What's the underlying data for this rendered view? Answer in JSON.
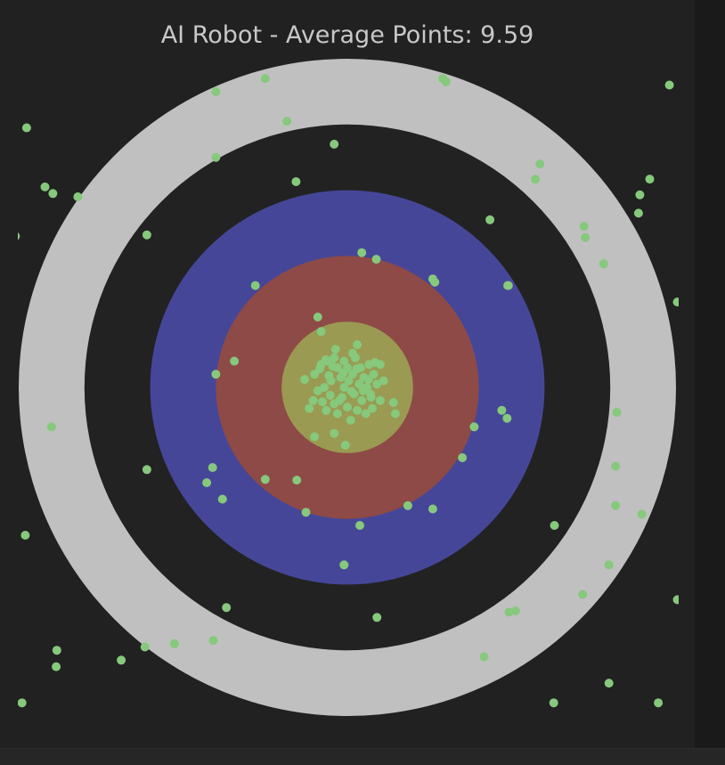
{
  "chart_data": {
    "type": "scatter",
    "title": "AI Robot - Average Points: 9.59",
    "xlabel": "",
    "ylabel": "",
    "xlim": [
      -5.5,
      5.5
    ],
    "ylim": [
      -5.5,
      5.5
    ],
    "grid": false,
    "rings": [
      {
        "radius": 5,
        "color": "#c0c0c0"
      },
      {
        "radius": 4,
        "color": "#222222"
      },
      {
        "radius": 3,
        "color": "#464699"
      },
      {
        "radius": 2,
        "color": "#8e4a46"
      },
      {
        "radius": 1,
        "color": "#9a9a52"
      }
    ],
    "point_color": "#86c87c",
    "points": [
      [
        -4.88,
        3.95
      ],
      [
        -4.6,
        3.05
      ],
      [
        -4.48,
        2.95
      ],
      [
        -4.1,
        2.9
      ],
      [
        -5.05,
        2.3
      ],
      [
        -3.05,
        2.32
      ],
      [
        -2.0,
        3.5
      ],
      [
        -2.0,
        4.5
      ],
      [
        -1.25,
        4.7
      ],
      [
        -0.92,
        4.05
      ],
      [
        -0.78,
        3.13
      ],
      [
        -0.2,
        3.7
      ],
      [
        1.45,
        4.7
      ],
      [
        1.5,
        4.65
      ],
      [
        4.9,
        4.6
      ],
      [
        2.93,
        3.4
      ],
      [
        2.86,
        3.17
      ],
      [
        4.6,
        3.17
      ],
      [
        4.45,
        2.93
      ],
      [
        4.43,
        2.65
      ],
      [
        3.6,
        2.45
      ],
      [
        3.62,
        2.28
      ],
      [
        3.9,
        1.88
      ],
      [
        2.17,
        2.55
      ],
      [
        5.02,
        1.3
      ],
      [
        2.45,
        1.55
      ],
      [
        4.1,
        -0.38
      ],
      [
        4.08,
        -1.2
      ],
      [
        4.08,
        -1.8
      ],
      [
        4.48,
        -1.93
      ],
      [
        3.15,
        -2.1
      ],
      [
        3.98,
        -2.7
      ],
      [
        3.58,
        -3.15
      ],
      [
        2.56,
        -3.4
      ],
      [
        2.46,
        -3.42
      ],
      [
        5.02,
        -3.23
      ],
      [
        3.98,
        -4.5
      ],
      [
        3.14,
        -4.8
      ],
      [
        4.73,
        -4.8
      ],
      [
        2.08,
        -4.1
      ],
      [
        0.45,
        -3.5
      ],
      [
        -4.42,
        -4.0
      ],
      [
        -4.43,
        -4.25
      ],
      [
        -3.44,
        -4.15
      ],
      [
        -3.08,
        -3.95
      ],
      [
        -2.63,
        -3.9
      ],
      [
        -2.04,
        -3.85
      ],
      [
        -1.84,
        -3.35
      ],
      [
        -4.95,
        -4.8
      ],
      [
        -4.9,
        -2.25
      ],
      [
        -4.5,
        -0.6
      ],
      [
        -3.05,
        -1.25
      ],
      [
        -2.05,
        -1.22
      ],
      [
        -2.14,
        -1.45
      ],
      [
        -1.9,
        -1.7
      ],
      [
        -1.25,
        -1.4
      ],
      [
        -0.77,
        -1.41
      ],
      [
        -0.63,
        -1.9
      ],
      [
        -0.05,
        -2.7
      ],
      [
        0.19,
        -2.1
      ],
      [
        0.92,
        -1.8
      ],
      [
        1.3,
        -1.85
      ],
      [
        1.75,
        -1.07
      ],
      [
        1.93,
        -0.6
      ],
      [
        2.35,
        -0.35
      ],
      [
        2.43,
        -0.47
      ],
      [
        -2.0,
        0.2
      ],
      [
        -1.72,
        0.4
      ],
      [
        -0.45,
        1.07
      ],
      [
        -0.4,
        0.85
      ],
      [
        0.22,
        2.05
      ],
      [
        0.44,
        1.95
      ],
      [
        -1.4,
        1.55
      ],
      [
        1.3,
        1.65
      ],
      [
        1.33,
        1.6
      ],
      [
        2.44,
        1.55
      ],
      [
        0.35,
        -0.1
      ],
      [
        0.73,
        -0.4
      ],
      [
        0.7,
        -0.23
      ],
      [
        -0.5,
        -0.75
      ],
      [
        -0.2,
        -0.7
      ],
      [
        -0.03,
        -0.88
      ],
      [
        0.15,
        0.65
      ],
      [
        -0.18,
        0.58
      ],
      [
        0.5,
        0.35
      ],
      [
        -0.65,
        0.12
      ],
      [
        -0.52,
        -0.2
      ],
      [
        -0.5,
        0.2
      ],
      [
        -0.4,
        0.35
      ],
      [
        -0.35,
        0.0
      ],
      [
        -0.32,
        -0.35
      ],
      [
        -0.3,
        0.4
      ],
      [
        -0.25,
        0.1
      ],
      [
        -0.2,
        0.45
      ],
      [
        -0.2,
        -0.25
      ],
      [
        -0.15,
        0.3
      ],
      [
        -0.15,
        -0.4
      ],
      [
        -0.1,
        0.15
      ],
      [
        -0.08,
        -0.15
      ],
      [
        -0.05,
        0.4
      ],
      [
        -0.05,
        0.0
      ],
      [
        0.0,
        0.3
      ],
      [
        0.0,
        -0.3
      ],
      [
        0.02,
        0.1
      ],
      [
        0.05,
        -0.5
      ],
      [
        0.08,
        0.2
      ],
      [
        0.1,
        -0.1
      ],
      [
        0.12,
        0.45
      ],
      [
        0.15,
        -0.35
      ],
      [
        0.18,
        0.05
      ],
      [
        0.2,
        0.3
      ],
      [
        0.22,
        -0.2
      ],
      [
        0.25,
        0.15
      ],
      [
        0.28,
        -0.4
      ],
      [
        0.3,
        0.0
      ],
      [
        0.33,
        0.35
      ],
      [
        0.36,
        -0.15
      ],
      [
        0.4,
        0.2
      ],
      [
        0.45,
        0.05
      ],
      [
        0.5,
        -0.2
      ],
      [
        -0.45,
        -0.05
      ],
      [
        -0.42,
        0.28
      ],
      [
        -0.38,
        -0.22
      ],
      [
        -0.28,
        0.18
      ],
      [
        -0.26,
        -0.12
      ],
      [
        -0.22,
        0.32
      ],
      [
        -0.12,
        -0.2
      ],
      [
        -0.06,
        0.22
      ],
      [
        0.06,
        -0.06
      ],
      [
        0.14,
        0.28
      ],
      [
        0.24,
        -0.05
      ],
      [
        0.32,
        0.12
      ],
      [
        0.38,
        -0.32
      ],
      [
        0.42,
        0.38
      ],
      [
        -0.33,
        0.42
      ],
      [
        0.08,
        0.52
      ],
      [
        -0.58,
        -0.32
      ],
      [
        0.55,
        0.1
      ]
    ]
  }
}
